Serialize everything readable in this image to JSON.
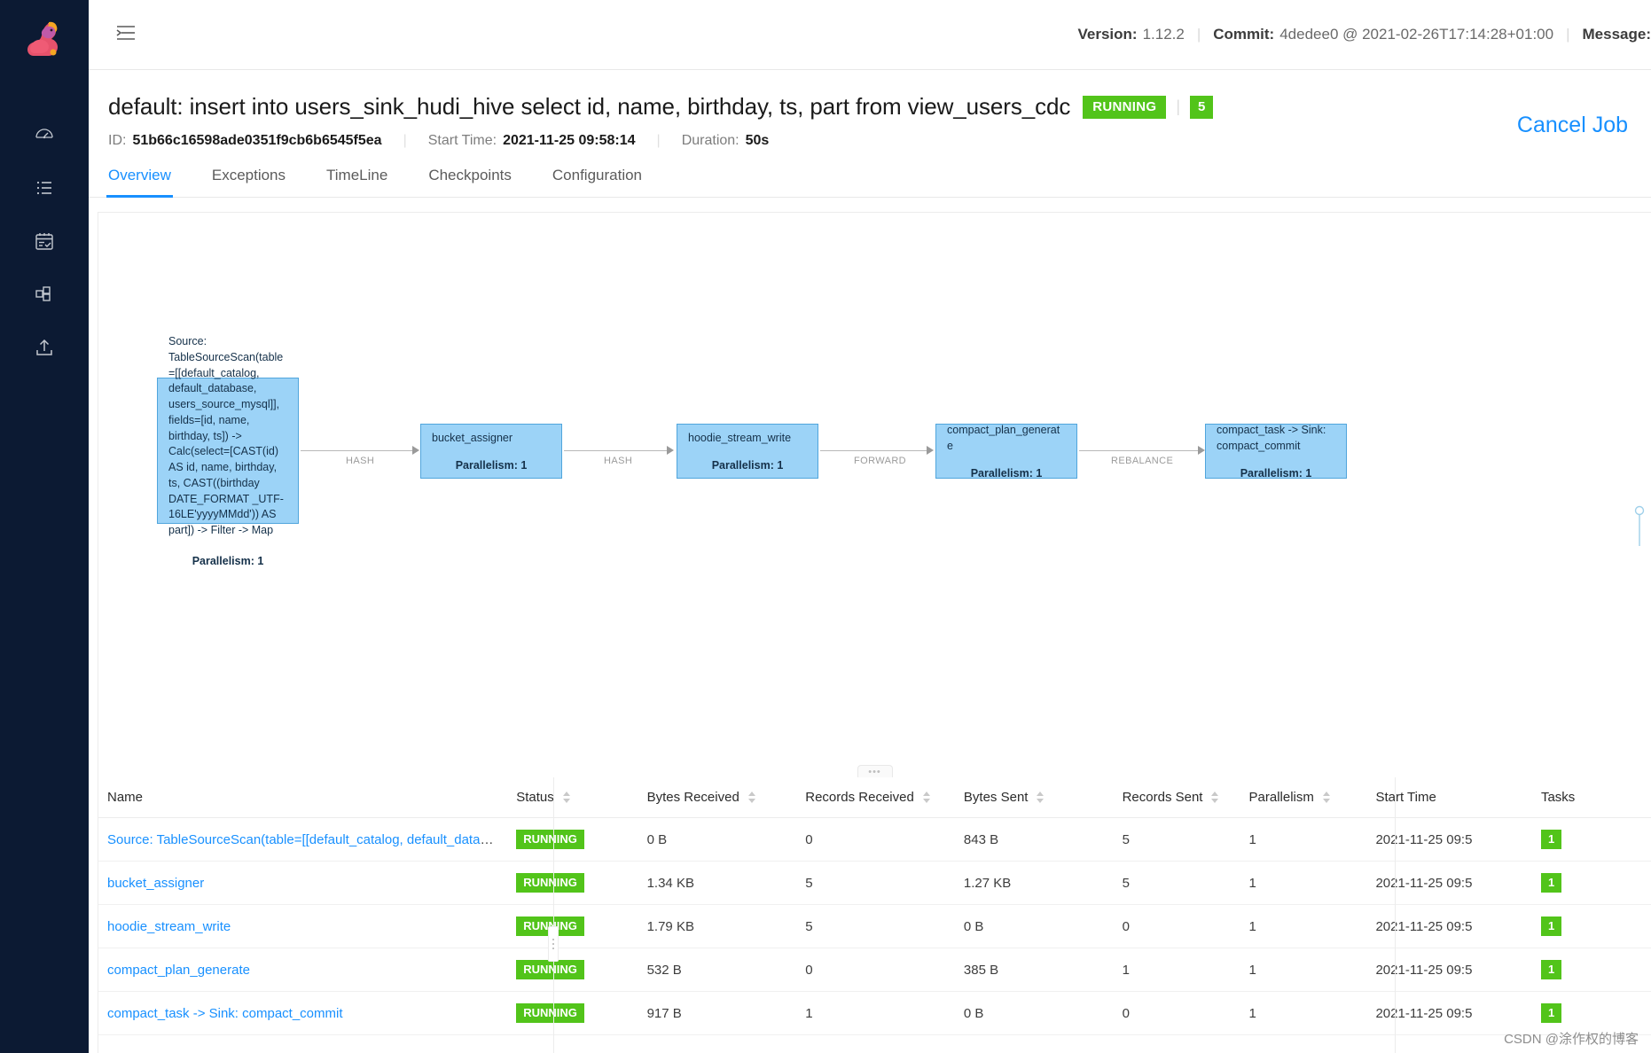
{
  "sidebar": {
    "logo_name": "flink-squirrel-logo",
    "items": [
      {
        "icon": "gauge-icon",
        "name": "overview"
      },
      {
        "icon": "list-icon",
        "name": "running-jobs"
      },
      {
        "icon": "calendar-check-icon",
        "name": "completed-jobs"
      },
      {
        "icon": "task-managers-icon",
        "name": "task-managers"
      },
      {
        "icon": "upload-icon",
        "name": "submit-new-job"
      }
    ]
  },
  "topbar": {
    "menu_icon": "hamburger-icon",
    "version_label": "Version:",
    "version_value": "1.12.2",
    "commit_label": "Commit:",
    "commit_value": "4dedee0 @ 2021-02-26T17:14:28+01:00",
    "message_label": "Message:"
  },
  "job": {
    "title": "default: insert into users_sink_hudi_hive select id, name, birthday, ts, part from view_users_cdc",
    "status": "RUNNING",
    "task_count": "5",
    "id_label": "ID:",
    "id_value": "51b66c16598ade0351f9cb6b6545f5ea",
    "start_time_label": "Start Time:",
    "start_time_value": "2021-11-25 09:58:14",
    "duration_label": "Duration:",
    "duration_value": "50s",
    "cancel_label": "Cancel Job"
  },
  "tabs": [
    {
      "label": "Overview",
      "active": true
    },
    {
      "label": "Exceptions",
      "active": false
    },
    {
      "label": "TimeLine",
      "active": false
    },
    {
      "label": "Checkpoints",
      "active": false
    },
    {
      "label": "Configuration",
      "active": false
    }
  ],
  "graph": {
    "node_fill": "#9cd3f7",
    "node_border": "#50a5dc",
    "nodes": [
      {
        "label": "Source: TableSourceScan(table=[[default_catalog, default_database, users_source_mysql]], fields=[id, name, birthday, ts]) -> Calc(select=[CAST(id) AS id, name, birthday, ts, CAST((birthday DATE_FORMAT _UTF-16LE'yyyyMMdd')) AS part]) -> Filter -> Map",
        "parallelism": "Parallelism: 1"
      },
      {
        "label": "bucket_assigner",
        "parallelism": "Parallelism: 1"
      },
      {
        "label": "hoodie_stream_write",
        "parallelism": "Parallelism: 1"
      },
      {
        "label": "compact_plan_generate",
        "parallelism": "Parallelism: 1"
      },
      {
        "label": "compact_task -> Sink: compact_commit",
        "parallelism": "Parallelism: 1"
      }
    ],
    "edges": [
      "HASH",
      "HASH",
      "FORWARD",
      "REBALANCE"
    ]
  },
  "splitter": {
    "dots": "•••"
  },
  "table": {
    "columns": [
      {
        "label": "Name",
        "sortable": false
      },
      {
        "label": "Status",
        "sortable": true
      },
      {
        "label": "Bytes Received",
        "sortable": true
      },
      {
        "label": "Records Received",
        "sortable": true
      },
      {
        "label": "Bytes Sent",
        "sortable": true
      },
      {
        "label": "Records Sent",
        "sortable": true
      },
      {
        "label": "Parallelism",
        "sortable": true
      },
      {
        "label": "Start Time",
        "sortable": false
      },
      {
        "label": "Tasks",
        "sortable": false
      }
    ],
    "rows": [
      {
        "name": "Source: TableSourceScan(table=[[default_catalog, default_database, u...",
        "status": "RUNNING",
        "bytes_received": "0 B",
        "records_received": "0",
        "bytes_sent": "843 B",
        "records_sent": "5",
        "parallelism": "1",
        "start_time": "2021-11-25 09:5",
        "tasks": "1"
      },
      {
        "name": "bucket_assigner",
        "status": "RUNNING",
        "bytes_received": "1.34 KB",
        "records_received": "5",
        "bytes_sent": "1.27 KB",
        "records_sent": "5",
        "parallelism": "1",
        "start_time": "2021-11-25 09:5",
        "tasks": "1"
      },
      {
        "name": "hoodie_stream_write",
        "status": "RUNNING",
        "bytes_received": "1.79 KB",
        "records_received": "5",
        "bytes_sent": "0 B",
        "records_sent": "0",
        "parallelism": "1",
        "start_time": "2021-11-25 09:5",
        "tasks": "1"
      },
      {
        "name": "compact_plan_generate",
        "status": "RUNNING",
        "bytes_received": "532 B",
        "records_received": "0",
        "bytes_sent": "385 B",
        "records_sent": "1",
        "parallelism": "1",
        "start_time": "2021-11-25 09:5",
        "tasks": "1"
      },
      {
        "name": "compact_task -> Sink: compact_commit",
        "status": "RUNNING",
        "bytes_received": "917 B",
        "records_received": "1",
        "bytes_sent": "0 B",
        "records_sent": "0",
        "parallelism": "1",
        "start_time": "2021-11-25 09:5",
        "tasks": "1"
      }
    ]
  },
  "watermark": "CSDN @涂作权的博客",
  "colors": {
    "accent": "#1890ff",
    "success": "#52c41a",
    "sidebar": "#0c1a33"
  }
}
